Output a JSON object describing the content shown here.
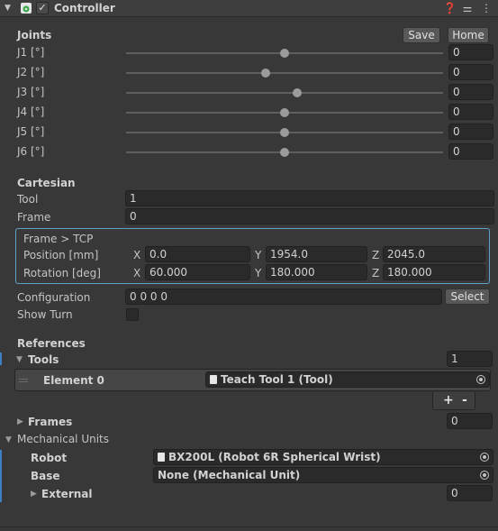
{
  "header": {
    "title": "Controller",
    "enabled": true
  },
  "joints": {
    "title": "Joints",
    "save_label": "Save",
    "home_label": "Home",
    "items": [
      {
        "label": "J1 [°]",
        "value": "0",
        "slider_fraction": 0.5
      },
      {
        "label": "J2 [°]",
        "value": "0",
        "slider_fraction": 0.44
      },
      {
        "label": "J3 [°]",
        "value": "0",
        "slider_fraction": 0.54
      },
      {
        "label": "J4 [°]",
        "value": "0",
        "slider_fraction": 0.5
      },
      {
        "label": "J5 [°]",
        "value": "0",
        "slider_fraction": 0.5
      },
      {
        "label": "J6 [°]",
        "value": "0",
        "slider_fraction": 0.5
      }
    ]
  },
  "cartesian": {
    "title": "Cartesian",
    "tool_label": "Tool",
    "tool_value": "1",
    "frame_label": "Frame",
    "frame_value": "0",
    "frame_tcp": {
      "title": "Frame > TCP",
      "position_label": "Position [mm]",
      "rotation_label": "Rotation [deg]",
      "x_label": "X",
      "y_label": "Y",
      "z_label": "Z",
      "position": {
        "x": "0.0",
        "y": "1954.0",
        "z": "2045.0"
      },
      "rotation": {
        "x": "60.000",
        "y": "180.000",
        "z": "180.000"
      }
    },
    "configuration_label": "Configuration",
    "configuration_value": "0 0 0 0",
    "select_label": "Select",
    "show_turn_label": "Show Turn",
    "show_turn_checked": false
  },
  "references": {
    "title": "References",
    "tools_label": "Tools",
    "tools_count": "1",
    "element0_label": "Element 0",
    "element0_value": "Teach Tool 1 (Tool)",
    "plus_label": "+",
    "minus_label": "-",
    "frames_label": "Frames",
    "frames_count": "0",
    "mech_units_label": "Mechanical Units",
    "robot_label": "Robot",
    "robot_value": "BX200L (Robot 6R Spherical Wrist)",
    "base_label": "Base",
    "base_value": "None (Mechanical Unit)",
    "external_label": "External",
    "external_count": "0"
  },
  "colors": {
    "background": "#383838",
    "field": "#2a2a2a",
    "accent_blue": "#3d7fc4",
    "frame_border": "#5aa0c8"
  }
}
